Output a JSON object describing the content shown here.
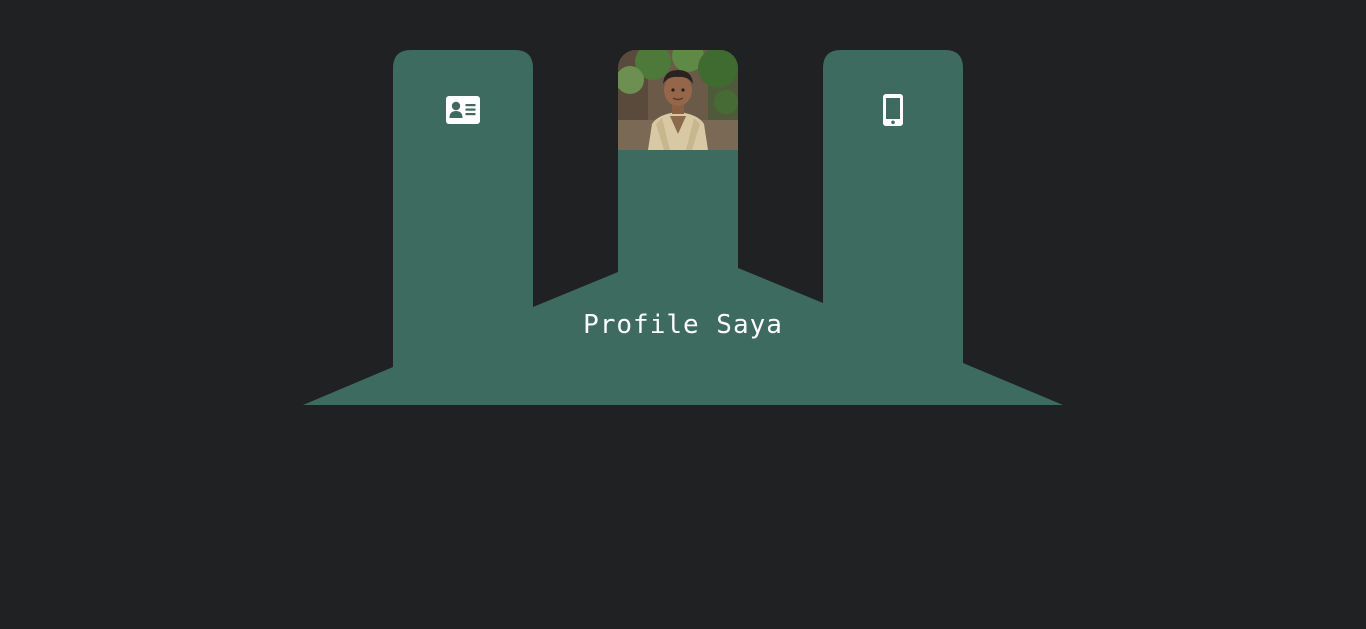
{
  "colors": {
    "background": "#202123",
    "panel": "#3d6b60",
    "icon": "#ffffff"
  },
  "profile": {
    "title": "Profile Saya",
    "left_tab_icon": "id-card-icon",
    "center_tab_image": "profile-photo",
    "right_tab_icon": "mobile-phone-icon"
  }
}
